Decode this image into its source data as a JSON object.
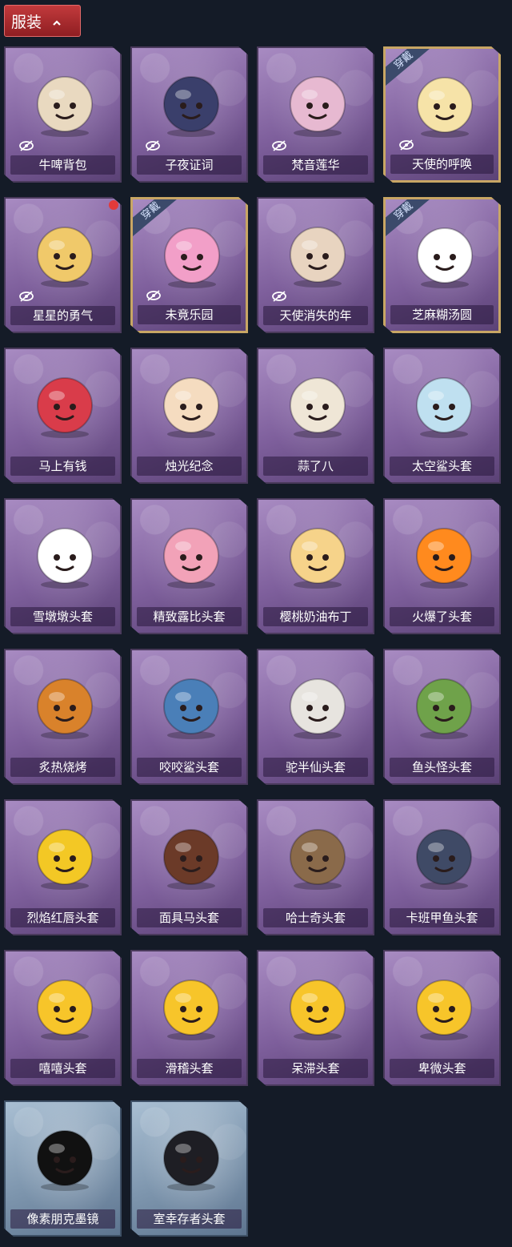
{
  "header": {
    "title": "服装"
  },
  "worn_label": "穿戴",
  "items": [
    {
      "label": "牛啤背包",
      "hidden": true,
      "worn": false,
      "art": "cow-backpack-icon",
      "color": "#e9d9c0"
    },
    {
      "label": "子夜证词",
      "hidden": true,
      "worn": false,
      "art": "midnight-doll-icon",
      "color": "#3a3f6b"
    },
    {
      "label": "梵音莲华",
      "hidden": true,
      "worn": false,
      "art": "lotus-doll-icon",
      "color": "#e7b9d1"
    },
    {
      "label": "天使的呼唤",
      "hidden": true,
      "worn": true,
      "art": "angel-doll-icon",
      "color": "#f6e3a8"
    },
    {
      "label": "星星的勇气",
      "hidden": true,
      "worn": false,
      "art": "star-pendant-icon",
      "color": "#f0c96a",
      "dot": true
    },
    {
      "label": "未竟乐园",
      "hidden": true,
      "worn": true,
      "art": "paradise-doll-icon",
      "color": "#f29fc8"
    },
    {
      "label": "天使消失的年",
      "hidden": true,
      "worn": false,
      "art": "fading-angel-icon",
      "color": "#e8d4c0"
    },
    {
      "label": "芝麻糊汤圆",
      "hidden": false,
      "worn": true,
      "art": "tangyuan-icon",
      "color": "#ffffff"
    },
    {
      "label": "马上有钱",
      "hidden": false,
      "worn": false,
      "art": "horse-head-icon",
      "color": "#d93c4a"
    },
    {
      "label": "烛光纪念",
      "hidden": false,
      "worn": false,
      "art": "candle-head-icon",
      "color": "#f5dcc0"
    },
    {
      "label": "蒜了八",
      "hidden": false,
      "worn": false,
      "art": "garlic-head-icon",
      "color": "#efe6d6"
    },
    {
      "label": "太空鲨头套",
      "hidden": false,
      "worn": false,
      "art": "space-shark-icon",
      "color": "#bfe0f0"
    },
    {
      "label": "雪墩墩头套",
      "hidden": false,
      "worn": false,
      "art": "snowman-head-icon",
      "color": "#ffffff"
    },
    {
      "label": "精致露比头套",
      "hidden": false,
      "worn": false,
      "art": "loopy-head-icon",
      "color": "#f2a2b8"
    },
    {
      "label": "樱桃奶油布丁",
      "hidden": false,
      "worn": false,
      "art": "pudding-head-icon",
      "color": "#f6d38a"
    },
    {
      "label": "火爆了头套",
      "hidden": false,
      "worn": false,
      "art": "fire-head-icon",
      "color": "#ff8a1e"
    },
    {
      "label": "炙热烧烤",
      "hidden": false,
      "worn": false,
      "art": "bbq-head-icon",
      "color": "#d9822b"
    },
    {
      "label": "咬咬鲨头套",
      "hidden": false,
      "worn": false,
      "art": "biting-shark-icon",
      "color": "#4a7fb8"
    },
    {
      "label": "驼半仙头套",
      "hidden": false,
      "worn": false,
      "art": "bear-sunglasses-icon",
      "color": "#e7e4df"
    },
    {
      "label": "鱼头怪头套",
      "hidden": false,
      "worn": false,
      "art": "fish-monster-icon",
      "color": "#6fa24a"
    },
    {
      "label": "烈焰红唇头套",
      "hidden": false,
      "worn": false,
      "art": "yellow-mouse-icon",
      "color": "#f3c825"
    },
    {
      "label": "面具马头套",
      "hidden": false,
      "worn": false,
      "art": "horse-mask-icon",
      "color": "#6b3a28"
    },
    {
      "label": "哈士奇头套",
      "hidden": false,
      "worn": false,
      "art": "husky-head-icon",
      "color": "#8a6a4a"
    },
    {
      "label": "卡班甲鱼头套",
      "hidden": false,
      "worn": false,
      "art": "whale-head-icon",
      "color": "#3f4a66"
    },
    {
      "label": "嘻嘻头套",
      "hidden": false,
      "worn": false,
      "art": "grin-emoji-icon",
      "color": "#f7c52a"
    },
    {
      "label": "滑稽头套",
      "hidden": false,
      "worn": false,
      "art": "funny-emoji-icon",
      "color": "#f7c52a"
    },
    {
      "label": "呆滞头套",
      "hidden": false,
      "worn": false,
      "art": "dazed-emoji-icon",
      "color": "#f7c52a"
    },
    {
      "label": "卑微头套",
      "hidden": false,
      "worn": false,
      "art": "humble-emoji-icon",
      "color": "#f7c52a"
    },
    {
      "label": "像素朋克墨镜",
      "hidden": false,
      "worn": false,
      "art": "pixel-sunglasses-icon",
      "color": "#111111",
      "blue": true
    },
    {
      "label": "室幸存者头套",
      "hidden": false,
      "worn": false,
      "art": "gas-mask-icon",
      "color": "#1e1e24",
      "blue": true
    }
  ]
}
